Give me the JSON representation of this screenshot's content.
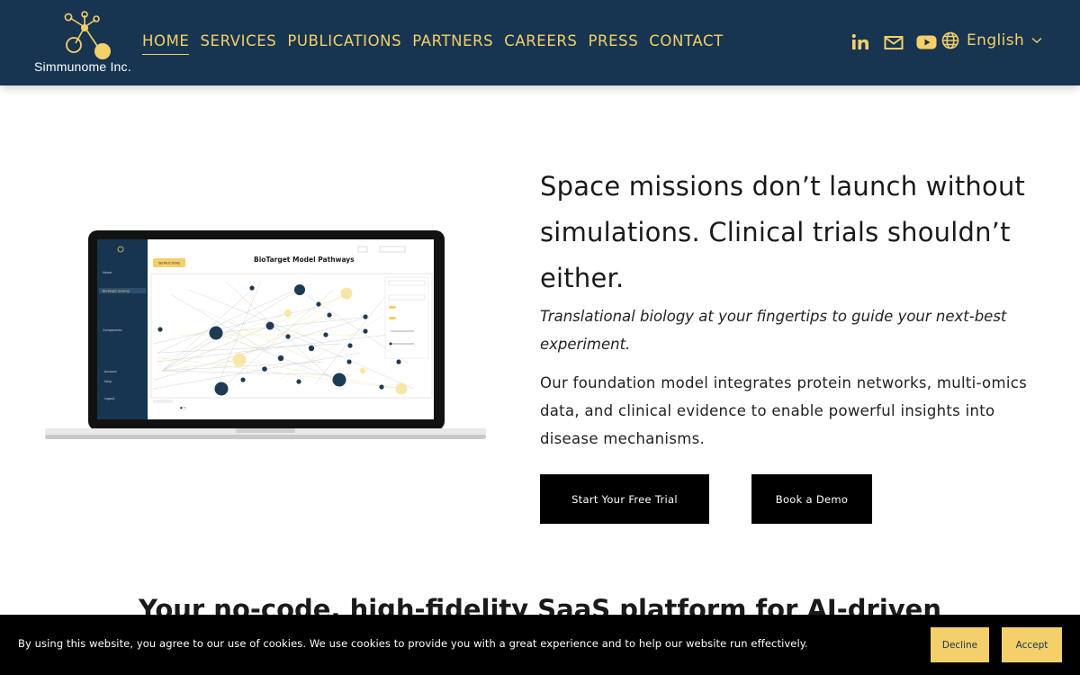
{
  "brand": {
    "logo_text": "Simmunome Inc.",
    "colors": {
      "header_bg": "#173550",
      "accent": "#f4cf6a",
      "button_bg": "#000000"
    }
  },
  "nav": {
    "items": [
      {
        "label": "HOME",
        "active": true
      },
      {
        "label": "SERVICES"
      },
      {
        "label": "PUBLICATIONS"
      },
      {
        "label": "PARTNERS"
      },
      {
        "label": "CAREERS"
      },
      {
        "label": "PRESS"
      },
      {
        "label": "CONTACT"
      }
    ],
    "social_icons": [
      "linkedin-icon",
      "mail-icon",
      "youtube-icon"
    ],
    "language": {
      "icon": "globe-icon",
      "label": "English"
    }
  },
  "hero": {
    "headline": "Space missions don’t launch without simulations. Clinical trials shouldn’t either.",
    "subheadline": "Translational biology at your fingertips to guide your next-best experiment.",
    "body": "Our foundation model integrates protein networks, multi-omics data, and clinical evidence to enable powerful insights into disease mechanisms.",
    "cta_primary": "Start Your Free Trial",
    "cta_secondary": "Book a Demo",
    "screen": {
      "title": "BioTarget Model Pathways",
      "instructions_button": "INSTRUCTIONS",
      "sidebar_items": [
        "Home",
        "BioTarget Scoring",
        "Components",
        "Account",
        "Help",
        "Logout"
      ]
    }
  },
  "section": {
    "title": "Your no-code, high-fidelity SaaS platform for AI-driven"
  },
  "cookie": {
    "message": "By using this website, you agree to our use of cookies. We use cookies to provide you with a great experience and to help our website run effectively.",
    "decline": "Decline",
    "accept": "Accept"
  }
}
